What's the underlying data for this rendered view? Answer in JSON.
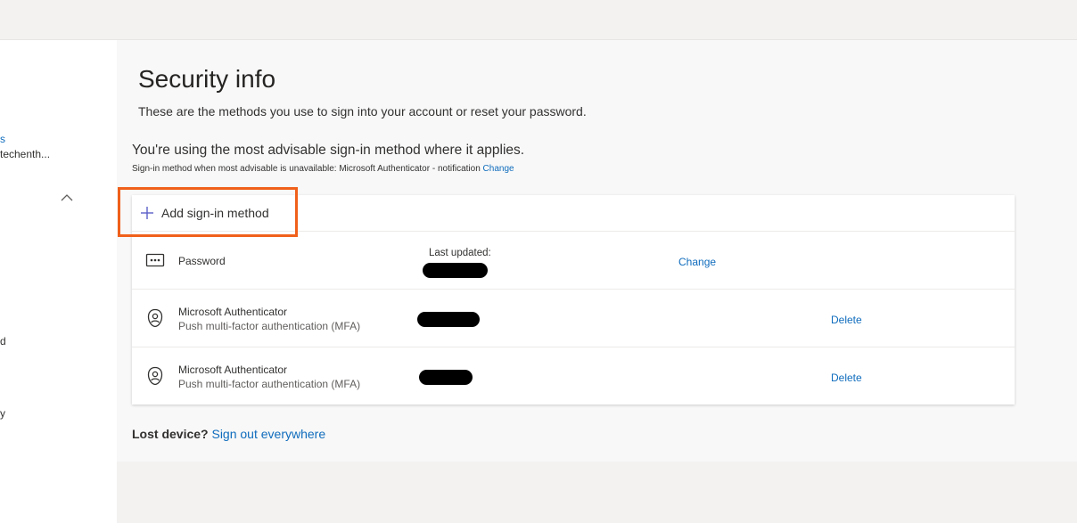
{
  "leftnav": {
    "frag_link": "s",
    "frag_account": "techenth...",
    "frag_d": "d",
    "frag_y": "y"
  },
  "page": {
    "title": "Security info",
    "subtitle": "These are the methods you use to sign into your account or reset your password."
  },
  "advisable": {
    "heading": "You're using the most advisable sign-in method where it applies.",
    "detail": "Sign-in method when most advisable is unavailable: Microsoft Authenticator - notification",
    "change_link": "Change"
  },
  "add_method": {
    "label": "Add sign-in method",
    "icon": "plus-icon"
  },
  "methods": [
    {
      "icon": "password-icon",
      "name": "Password",
      "updated_label": "Last updated:",
      "action": "Change"
    },
    {
      "icon": "authenticator-icon",
      "name": "Microsoft Authenticator",
      "description": "Push multi-factor authentication (MFA)",
      "action": "Delete"
    },
    {
      "icon": "authenticator-icon",
      "name": "Microsoft Authenticator",
      "description": "Push multi-factor authentication (MFA)",
      "action": "Delete"
    }
  ],
  "lost_device": {
    "question": "Lost device?",
    "link": "Sign out everywhere"
  },
  "colors": {
    "accent": "#0f6cbd",
    "highlight": "#f0601a",
    "background": "#f3f2f1"
  }
}
